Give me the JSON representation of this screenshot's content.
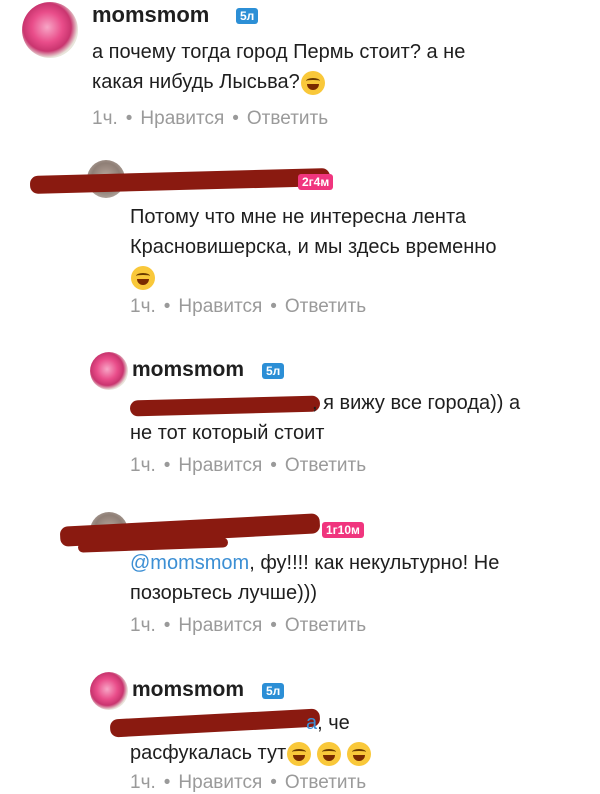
{
  "comments": [
    {
      "username": "momsmom",
      "badge": "5л",
      "line1": "а почему тогда город Пермь стоит? а не",
      "line2": "какая нибудь Лысьва?",
      "emoji": "laughing-tears",
      "time": "1ч.",
      "like": "Нравится",
      "reply": "Ответить"
    },
    {
      "badge": "2г4м",
      "line1": "Потому что мне не интересна лента",
      "line2": "Красновишерска, и мы здесь временно",
      "emoji": "smirk",
      "time": "1ч.",
      "like": "Нравится",
      "reply": "Ответить"
    },
    {
      "username": "momsmom",
      "badge": "5л",
      "line1_suffix": ", я вижу все города)) а",
      "line2": "не тот который стоит",
      "time": "1ч.",
      "like": "Нравится",
      "reply": "Ответить"
    },
    {
      "badge": "1г10м",
      "mention": "@momsmom",
      "line1_suffix": ", фу!!!! как некультурно! Не",
      "line2": "позорьтесь лучше)))",
      "time": "1ч.",
      "like": "Нравится",
      "reply": "Ответить"
    },
    {
      "username": "momsmom",
      "badge": "5л",
      "line1_mention_end": "а",
      "line1_suffix": ", че",
      "line2": "расфукалась тут",
      "emoji": "laughing-tears",
      "time": "1ч.",
      "like": "Нравится",
      "reply": "Ответить"
    }
  ],
  "meta_separator": "•"
}
